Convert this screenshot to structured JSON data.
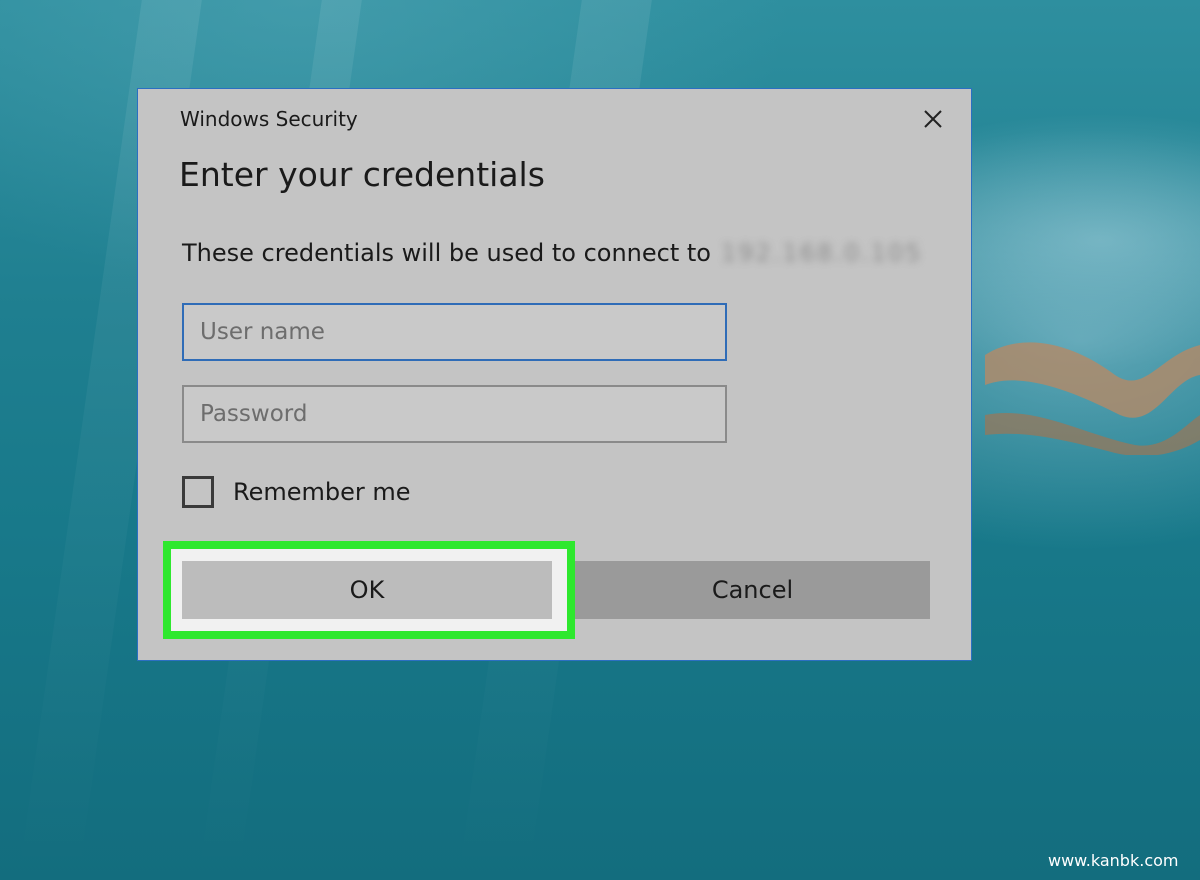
{
  "dialog": {
    "window_title": "Windows Security",
    "heading": "Enter your credentials",
    "message": "These credentials will be used to connect to",
    "target_blurred": "192.168.0.105",
    "username_placeholder": "User name",
    "password_placeholder": "Password",
    "remember_label": "Remember me",
    "remember_checked": false,
    "ok_label": "OK",
    "cancel_label": "Cancel"
  },
  "highlight_color": "#2ee82e",
  "accent_border_color": "#2f6cb7",
  "watermark": "www.kanbk.com",
  "icons": {
    "close": "close-icon"
  }
}
